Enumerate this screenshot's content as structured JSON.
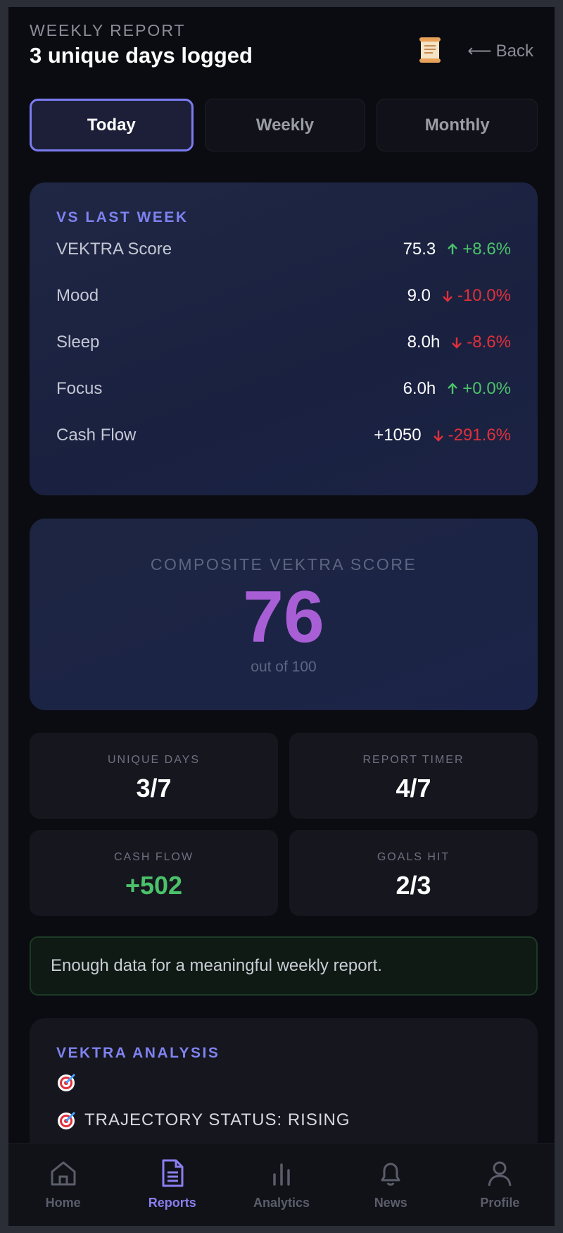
{
  "header": {
    "eyebrow": "WEEKLY REPORT",
    "title": "3 unique days logged",
    "doc_icon": "scroll-icon",
    "back_arrow": "⟵",
    "back_label": "Back"
  },
  "tabs": [
    {
      "label": "Today",
      "active": true
    },
    {
      "label": "Weekly",
      "active": false
    },
    {
      "label": "Monthly",
      "active": false
    }
  ],
  "vs_last_week": {
    "label": "VS LAST WEEK",
    "rows": [
      {
        "name": "VEKTRA Score",
        "value": "75.3",
        "delta": "+8.6%",
        "direction": "up"
      },
      {
        "name": "Mood",
        "value": "9.0",
        "delta": "-10.0%",
        "direction": "down"
      },
      {
        "name": "Sleep",
        "value": "8.0h",
        "delta": "-8.6%",
        "direction": "down"
      },
      {
        "name": "Focus",
        "value": "6.0h",
        "delta": "+0.0%",
        "direction": "up"
      },
      {
        "name": "Cash Flow",
        "value": "+1050",
        "delta": "-291.6%",
        "direction": "down"
      }
    ]
  },
  "composite": {
    "label": "COMPOSITE VEKTRA SCORE",
    "score": "76",
    "sub": "out of 100"
  },
  "stats": [
    {
      "label": "UNIQUE DAYS",
      "value": "3/7",
      "color": "white"
    },
    {
      "label": "REPORT TIMER",
      "value": "4/7",
      "color": "white"
    },
    {
      "label": "CASH FLOW",
      "value": "+502",
      "color": "green"
    },
    {
      "label": "GOALS HIT",
      "value": "2/3",
      "color": "white"
    }
  ],
  "note": "Enough data for a meaningful weekly report.",
  "analysis": {
    "label": "VEKTRA ANALYSIS",
    "lines": [
      {
        "icon": "target-icon",
        "text": ""
      },
      {
        "icon": "target-icon",
        "text": "TRAJECTORY STATUS: RISING"
      }
    ]
  },
  "nav": [
    {
      "label": "Home",
      "icon": "home-icon",
      "active": false
    },
    {
      "label": "Reports",
      "icon": "reports-icon",
      "active": true
    },
    {
      "label": "Analytics",
      "icon": "analytics-icon",
      "active": false
    },
    {
      "label": "News",
      "icon": "bell-icon",
      "active": false
    },
    {
      "label": "Profile",
      "icon": "profile-icon",
      "active": false
    }
  ],
  "colors": {
    "accent": "#7b7cf0",
    "up": "#4bc26a",
    "down": "#e0303a",
    "score": "#a85fd6"
  }
}
